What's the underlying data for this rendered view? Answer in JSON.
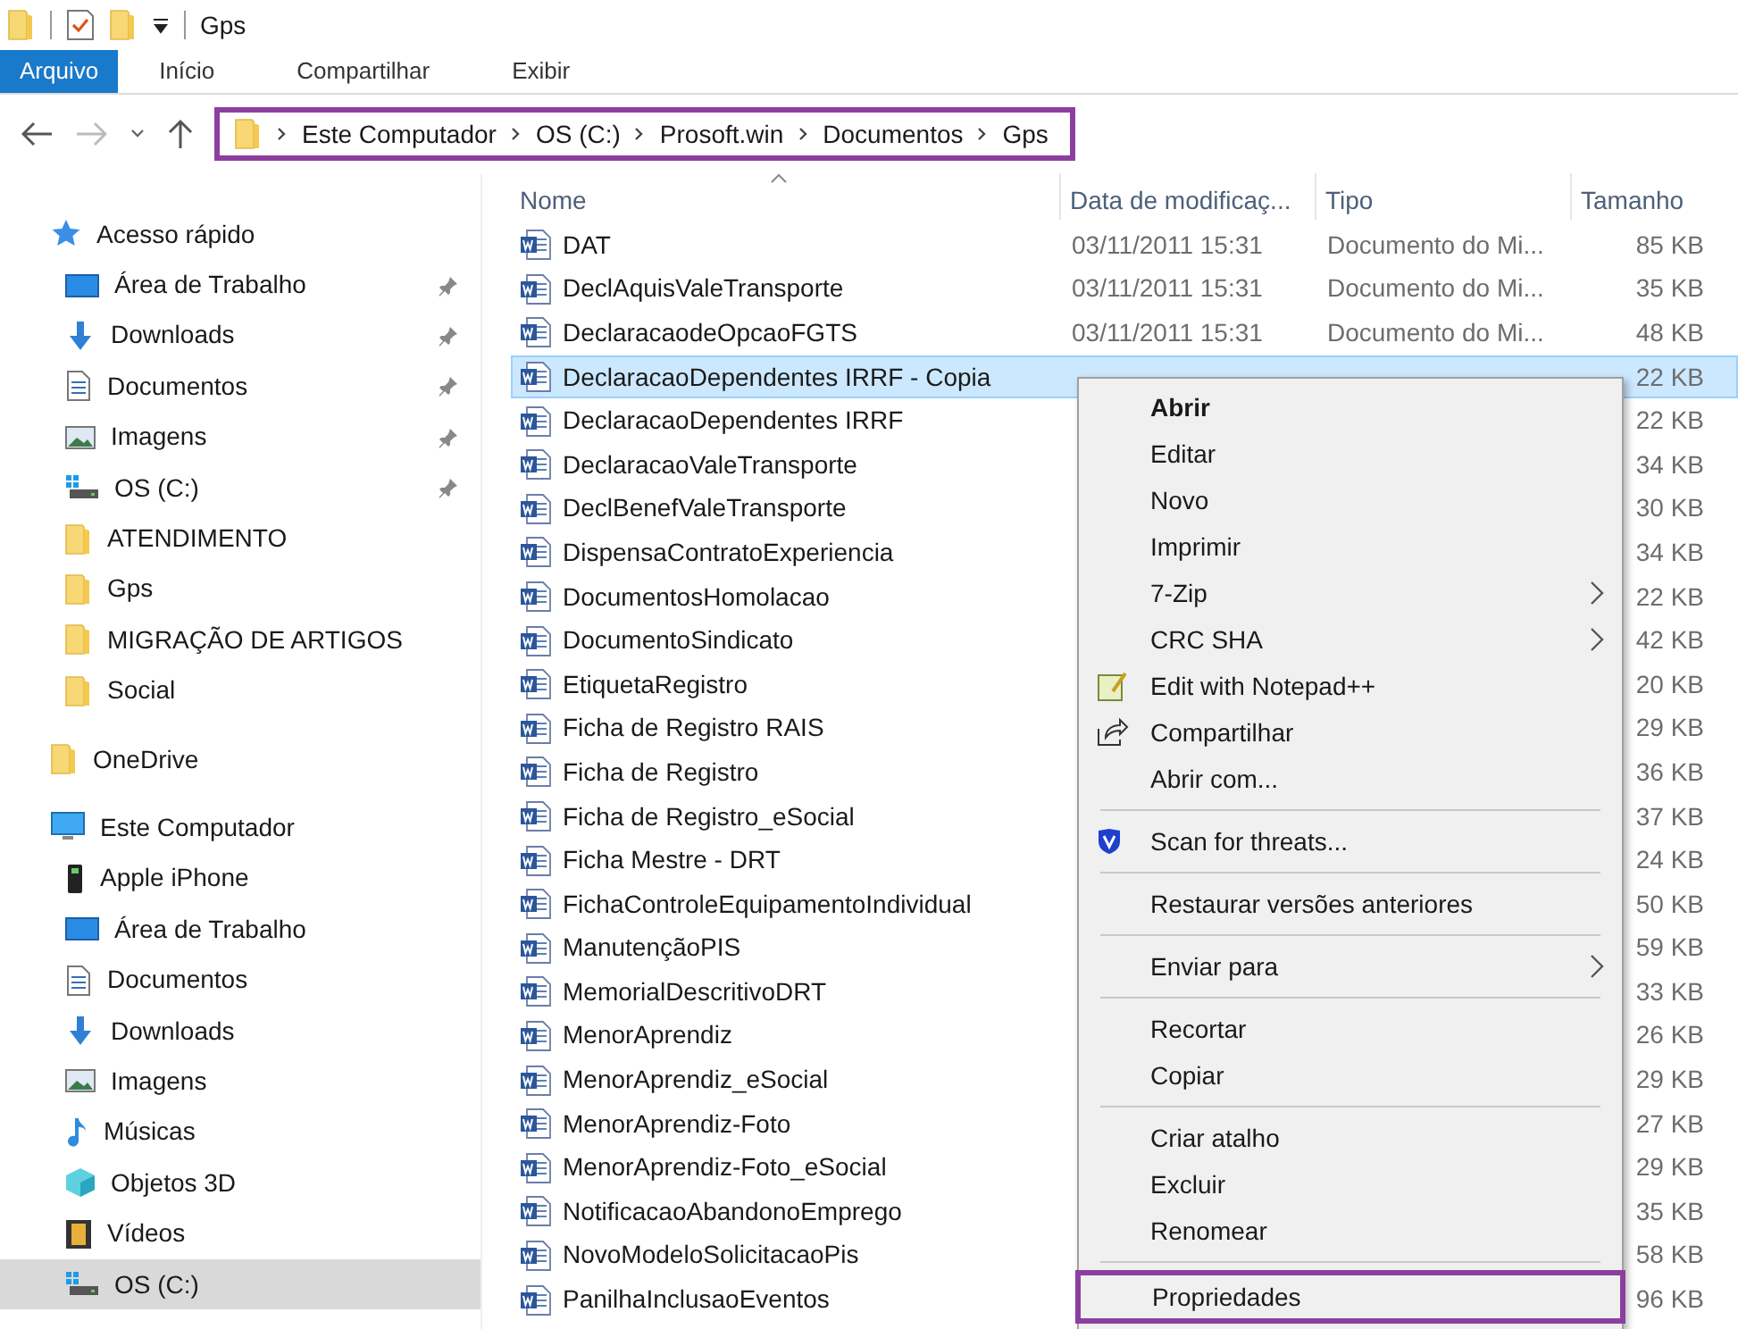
{
  "window": {
    "title": "Gps"
  },
  "ribbon_tabs": [
    {
      "label": "Arquivo",
      "selected": true
    },
    {
      "label": "Início",
      "selected": false
    },
    {
      "label": "Compartilhar",
      "selected": false
    },
    {
      "label": "Exibir",
      "selected": false
    }
  ],
  "address_bar": {
    "highlighted": true,
    "crumbs": [
      "Este Computador",
      "OS (C:)",
      "Prosoft.win",
      "Documentos",
      "Gps"
    ]
  },
  "sidebar": {
    "items": [
      {
        "label": "Acesso rápido",
        "kind": "star",
        "selected": false,
        "children": [
          {
            "label": "Área de Trabalho",
            "kind": "desktop",
            "pinned": true,
            "selected": false
          },
          {
            "label": "Downloads",
            "kind": "download",
            "pinned": true,
            "selected": false
          },
          {
            "label": "Documentos",
            "kind": "document",
            "pinned": true,
            "selected": false
          },
          {
            "label": "Imagens",
            "kind": "image",
            "pinned": true,
            "selected": false
          },
          {
            "label": "OS (C:)",
            "kind": "drive",
            "pinned": true,
            "selected": false
          },
          {
            "label": "ATENDIMENTO",
            "kind": "folder",
            "pinned": false,
            "selected": false
          },
          {
            "label": "Gps",
            "kind": "folder",
            "pinned": false,
            "selected": false
          },
          {
            "label": "MIGRAÇÃO DE ARTIGOS",
            "kind": "folder",
            "pinned": false,
            "selected": false
          },
          {
            "label": "Social",
            "kind": "folder",
            "pinned": false,
            "selected": false
          }
        ]
      },
      {
        "label": "OneDrive",
        "kind": "folder",
        "selected": false
      },
      {
        "label": "Este Computador",
        "kind": "computer",
        "selected": false,
        "children": [
          {
            "label": "Apple iPhone",
            "kind": "phone",
            "selected": false
          },
          {
            "label": "Área de Trabalho",
            "kind": "desktop",
            "selected": false
          },
          {
            "label": "Documentos",
            "kind": "document",
            "selected": false
          },
          {
            "label": "Downloads",
            "kind": "download",
            "selected": false
          },
          {
            "label": "Imagens",
            "kind": "image",
            "selected": false
          },
          {
            "label": "Músicas",
            "kind": "music",
            "selected": false
          },
          {
            "label": "Objetos 3D",
            "kind": "cube",
            "selected": false
          },
          {
            "label": "Vídeos",
            "kind": "film",
            "selected": false
          },
          {
            "label": "OS (C:)",
            "kind": "drive",
            "selected": true
          }
        ]
      }
    ]
  },
  "table": {
    "columns": [
      "Nome",
      "Data de modificaç...",
      "Tipo",
      "Tamanho"
    ],
    "rows": [
      {
        "name": "DAT",
        "date": "03/11/2011 15:31",
        "type": "Documento do Mi...",
        "size": "85 KB",
        "selected": false
      },
      {
        "name": "DeclAquisValeTransporte",
        "date": "03/11/2011 15:31",
        "type": "Documento do Mi...",
        "size": "35 KB",
        "selected": false
      },
      {
        "name": "DeclaracaodeOpcaoFGTS",
        "date": "03/11/2011 15:31",
        "type": "Documento do Mi...",
        "size": "48 KB",
        "selected": false
      },
      {
        "name": "DeclaracaoDependentes IRRF - Copia",
        "size": "22 KB",
        "selected": true
      },
      {
        "name": "DeclaracaoDependentes IRRF",
        "size": "22 KB",
        "selected": false
      },
      {
        "name": "DeclaracaoValeTransporte",
        "size": "34 KB",
        "selected": false
      },
      {
        "name": "DeclBenefValeTransporte",
        "size": "30 KB",
        "selected": false
      },
      {
        "name": "DispensaContratoExperiencia",
        "size": "34 KB",
        "selected": false
      },
      {
        "name": "DocumentosHomolacao",
        "size": "22 KB",
        "selected": false
      },
      {
        "name": "DocumentoSindicato",
        "size": "42 KB",
        "selected": false
      },
      {
        "name": "EtiquetaRegistro",
        "size": "20 KB",
        "selected": false
      },
      {
        "name": "Ficha de Registro RAIS",
        "size": "29 KB",
        "selected": false
      },
      {
        "name": "Ficha de Registro",
        "size": "36 KB",
        "selected": false
      },
      {
        "name": "Ficha de Registro_eSocial",
        "size": "37 KB",
        "selected": false
      },
      {
        "name": "Ficha Mestre - DRT",
        "size": "24 KB",
        "selected": false
      },
      {
        "name": "FichaControleEquipamentoIndividual",
        "size": "50 KB",
        "selected": false
      },
      {
        "name": "ManutençãoPIS",
        "size": "59 KB",
        "selected": false
      },
      {
        "name": "MemorialDescritivoDRT",
        "size": "33 KB",
        "selected": false
      },
      {
        "name": "MenorAprendiz",
        "size": "26 KB",
        "selected": false
      },
      {
        "name": "MenorAprendiz_eSocial",
        "size": "29 KB",
        "selected": false
      },
      {
        "name": "MenorAprendiz-Foto",
        "size": "27 KB",
        "selected": false
      },
      {
        "name": "MenorAprendiz-Foto_eSocial",
        "size": "29 KB",
        "selected": false
      },
      {
        "name": "NotificacaoAbandonoEmprego",
        "size": "35 KB",
        "selected": false
      },
      {
        "name": "NovoModeloSolicitacaoPis",
        "size": "58 KB",
        "selected": false
      },
      {
        "name": "PanilhaInclusaoEventos",
        "size": "96 KB",
        "selected": false
      }
    ]
  },
  "context_menu": {
    "items": [
      {
        "kind": "item",
        "label": "Abrir",
        "bold": true
      },
      {
        "kind": "item",
        "label": "Editar"
      },
      {
        "kind": "item",
        "label": "Novo"
      },
      {
        "kind": "item",
        "label": "Imprimir"
      },
      {
        "kind": "item",
        "label": "7-Zip",
        "submenu": true
      },
      {
        "kind": "item",
        "label": "CRC SHA",
        "submenu": true
      },
      {
        "kind": "notepad",
        "label": "Edit with Notepad++"
      },
      {
        "kind": "share",
        "label": "Compartilhar"
      },
      {
        "kind": "item",
        "label": "Abrir com..."
      },
      {
        "kind": "separator"
      },
      {
        "kind": "shield",
        "label": "Scan for threats..."
      },
      {
        "kind": "separator"
      },
      {
        "kind": "item",
        "label": "Restaurar versões anteriores"
      },
      {
        "kind": "separator"
      },
      {
        "kind": "item",
        "label": "Enviar para",
        "submenu": true
      },
      {
        "kind": "separator"
      },
      {
        "kind": "item",
        "label": "Recortar"
      },
      {
        "kind": "item",
        "label": "Copiar"
      },
      {
        "kind": "separator"
      },
      {
        "kind": "item",
        "label": "Criar atalho"
      },
      {
        "kind": "item",
        "label": "Excluir"
      },
      {
        "kind": "item",
        "label": "Renomear"
      },
      {
        "kind": "separator"
      },
      {
        "kind": "item",
        "label": "Propriedades",
        "highlighted": true
      }
    ]
  }
}
